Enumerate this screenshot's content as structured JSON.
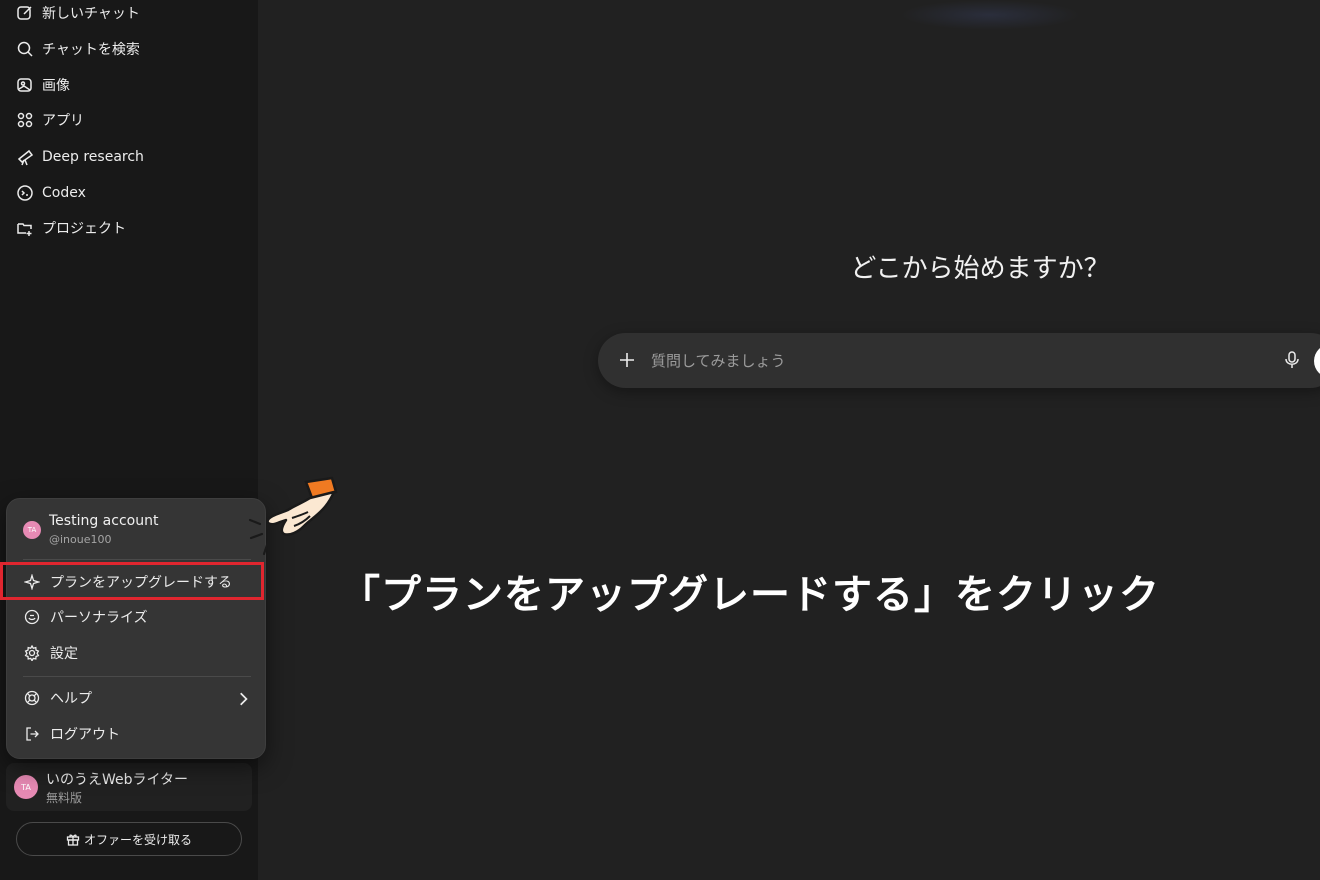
{
  "sidebar": {
    "items": [
      {
        "label": "新しいチャット",
        "icon": "edit-icon"
      },
      {
        "label": "チャットを検索",
        "icon": "search-icon"
      },
      {
        "label": "画像",
        "icon": "image-icon"
      },
      {
        "label": "アプリ",
        "icon": "apps-grid-icon"
      },
      {
        "label": "Deep research",
        "icon": "telescope-icon"
      },
      {
        "label": "Codex",
        "icon": "codex-icon"
      },
      {
        "label": "プロジェクト",
        "icon": "folder-plus-icon"
      }
    ]
  },
  "main": {
    "headline": "どこから始めますか？",
    "composer": {
      "placeholder": "質問してみましょう"
    }
  },
  "account_menu": {
    "avatar_initials": "TA",
    "account_name": "Testing account",
    "account_handle": "@inoue100",
    "items": [
      {
        "label": "プランをアップグレードする",
        "icon": "sparkle-icon"
      },
      {
        "label": "パーソナライズ",
        "icon": "personalize-icon"
      },
      {
        "label": "設定",
        "icon": "gear-icon"
      },
      {
        "label": "ヘルプ",
        "icon": "lifebuoy-icon"
      },
      {
        "label": "ログアウト",
        "icon": "logout-icon"
      }
    ]
  },
  "user": {
    "avatar_initials": "TA",
    "name": "いのうえWebライター",
    "plan": "無料版"
  },
  "offer_button": {
    "label": "オファーを受け取る",
    "icon": "gift-icon"
  },
  "annotation": {
    "instruction": "「プランをアップグレードする」をクリック"
  },
  "colors": {
    "highlight": "#e0262f",
    "avatar": "#e78ab4",
    "background": "#212121",
    "sidebar": "#181818"
  }
}
